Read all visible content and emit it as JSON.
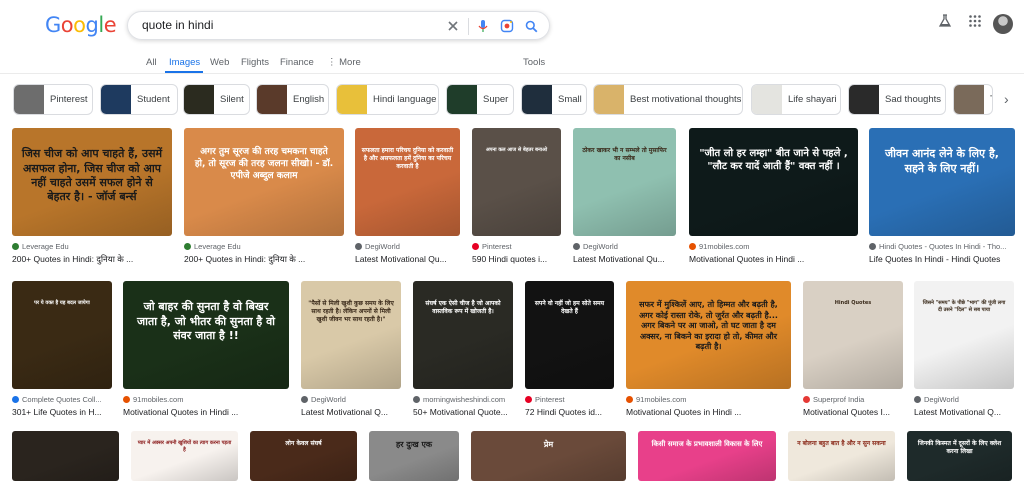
{
  "search": {
    "query": "quote in hindi"
  },
  "logo": {
    "letters": [
      "G",
      "o",
      "o",
      "g",
      "l",
      "e"
    ],
    "colors": [
      "#4285F4",
      "#EA4335",
      "#FBBC05",
      "#4285F4",
      "#34A853",
      "#EA4335"
    ]
  },
  "tabs": [
    {
      "label": "All"
    },
    {
      "label": "Images"
    },
    {
      "label": "Web"
    },
    {
      "label": "Flights"
    },
    {
      "label": "Finance"
    },
    {
      "label": "⋮ More"
    }
  ],
  "tools_label": "Tools",
  "chips": [
    {
      "label": "Pinterest",
      "color": "#6d6d6d"
    },
    {
      "label": "Student",
      "color": "#1e3a5f"
    },
    {
      "label": "Silent",
      "color": "#2b2b1f"
    },
    {
      "label": "English",
      "color": "#5a3a2a"
    },
    {
      "label": "Hindi language",
      "color": "#e8c03a"
    },
    {
      "label": "Super",
      "color": "#1f3d2a"
    },
    {
      "label": "Small",
      "color": "#1f2e3d"
    },
    {
      "label": "Best motivational thoughts",
      "color": "#d9b36a"
    },
    {
      "label": "Life shayari",
      "color": "#e4e4e0"
    },
    {
      "label": "Sad thoughts",
      "color": "#2a2a2a"
    },
    {
      "label": "Tru",
      "color": "#7a6a5a"
    }
  ],
  "row1": [
    {
      "text": "जिस चीज को आप चाहते हैं, उसमें असफल होना, जिस चीज को आप नहीं चाहते उसमें सफल होने से बेहतर है। - जॉर्ज बर्न्स",
      "bg": "#b8752a",
      "fg": "#1a1a1a",
      "source": "Leverage Edu",
      "fav": "#2e7d32",
      "caption": "200+ Quotes in Hindi: दुनिया के ..."
    },
    {
      "text": "अगर तुम सूरज की तरह चमकना चाहते हो, तो सूरज की तरह जलना सीखो। - डॉ. एपीजे अब्दुल कलाम",
      "bg": "#d98a4a",
      "fg": "#ffffff",
      "source": "Leverage Edu",
      "fav": "#2e7d32",
      "caption": "200+ Quotes in Hindi: दुनिया के ..."
    },
    {
      "text": "सफलता हमारा परिचय दुनिया को करवाती है और असफलता हमें दुनिया का परिचय करवाती है",
      "bg": "#c9683a",
      "fg": "#ffffff",
      "source": "DegiWorld",
      "fav": "#5f6368",
      "caption": "Latest Motivational Qu..."
    },
    {
      "text": "अपना कल आज से बेहतर बनाओ",
      "bg": "#5a5048",
      "fg": "#ffffff",
      "source": "Pinterest",
      "fav": "#e60023",
      "caption": "590 Hindi quotes i..."
    },
    {
      "text": "ठोकर खाकर भी न सम्भले तो मुसाफिर का नसीब",
      "bg": "#8fc0b0",
      "fg": "#3a2a1a",
      "source": "DegiWorld",
      "fav": "#5f6368",
      "caption": "Latest Motivational Qu..."
    },
    {
      "text": "\"जीत लो हर लम्हा\" बीत जाने से पहले , \"लौट कर यादें आती हैं\" वक्त नहीं ।",
      "bg": "#0e1a1a",
      "fg": "#ffffff",
      "source": "91mobiles.com",
      "fav": "#e65100",
      "caption": "Motivational Quotes in Hindi ..."
    },
    {
      "text": "जीवन आनंद लेने के लिए है, सहने के लिए नहीं।",
      "bg": "#2a6fb5",
      "fg": "#ffffff",
      "source": "Hindi Quotes - Quotes In Hindi - Tho...",
      "fav": "#5f6368",
      "caption": "Life Quotes In Hindi - Hindi Quotes"
    }
  ],
  "row2": [
    {
      "text": "पर ये वक्त है यह बदल जायेगा",
      "bg": "#3a2a14",
      "fg": "#ffffff",
      "source": "Complete Quotes Coll...",
      "fav": "#1a73e8",
      "caption": "301+ Life Quotes in H..."
    },
    {
      "text": "जो बाहर की सुनता है वो बिखर जाता है, जो भीतर की सुनता है वो संवर जाता है !!",
      "bg": "#1a3018",
      "fg": "#ffffff",
      "source": "91mobiles.com",
      "fav": "#e65100",
      "caption": "Motivational Quotes in Hindi ..."
    },
    {
      "text": "\"पैसों से मिली खुशी कुछ समय के लिए साथ रहती है। लेकिन अपनों से मिली खुशी जीवन भर साथ रहती है।\"",
      "bg": "#d9c9a8",
      "fg": "#3a2a1a",
      "source": "DegiWorld",
      "fav": "#5f6368",
      "caption": "Latest Motivational Q..."
    },
    {
      "text": "संघर्ष एक ऐसी चीज है जो आपको वास्तविक रूप में खोजती है।",
      "bg": "#2a2a24",
      "fg": "#ffffff",
      "source": "morningwisheshindi.com",
      "fav": "#5f6368",
      "caption": "50+ Motivational Quote..."
    },
    {
      "text": "सपने वो नहीं जो हम सोते समय देखते हैं",
      "bg": "#121212",
      "fg": "#ffffff",
      "source": "Pinterest",
      "fav": "#e60023",
      "caption": "72 Hindi Quotes id..."
    },
    {
      "text": "सफर में मुश्किलें आए, तो हिम्मत और बढ़ती है, अगर कोई रास्ता रोके, तो जुर्रत और बढ़ती है... अगर बिकने पर आ जाओ, तो घट जाता है दम अक्सर, ना बिकने का इरादा हो तो, कीमत और बढ़ती है।",
      "bg": "#e08a2a",
      "fg": "#1a1a1a",
      "source": "91mobiles.com",
      "fav": "#e65100",
      "caption": "Motivational Quotes in Hindi ..."
    },
    {
      "text": "Hindi Quotes",
      "bg": "#d9d0c4",
      "fg": "#3a2a1a",
      "source": "Superprof India",
      "fav": "#e53935",
      "caption": "Motivational Quotes I..."
    },
    {
      "text": "जिसने \"समय\" के पीछे \"भाग\" की पूंजी लगा दी उसने \"दिल\" से सब पाया",
      "bg": "#f2f2f2",
      "fg": "#3a2a1a",
      "source": "DegiWorld",
      "fav": "#5f6368",
      "caption": "Latest Motivational Q..."
    }
  ],
  "row3": [
    {
      "text": "",
      "bg": "#2a241e",
      "fg": "#ffffff"
    },
    {
      "text": "प्यार में अक्सर अपनी खुशियों का त्याग करना पड़ता है",
      "bg": "#f7f2ee",
      "fg": "#8a1a1a"
    },
    {
      "text": "लोग केवल संघर्ष",
      "bg": "#4a2a1a",
      "fg": "#ffffff"
    },
    {
      "text": "हर दुःख एक",
      "bg": "#8a8a8a",
      "fg": "#1a1a1a"
    },
    {
      "text": "प्रेम",
      "bg": "#6a4a3a",
      "fg": "#ffffff"
    },
    {
      "text": "किसी समाज के प्रभावशाली विकास के लिए",
      "bg": "#e8408a",
      "fg": "#ffffff"
    },
    {
      "text": "न बोलना बहुत बात है और न सुन सकना",
      "bg": "#efe8dc",
      "fg": "#8a2a1a"
    },
    {
      "text": "जिनकी किस्मत में दूसरों के लिए क्लेश करना लिखा",
      "bg": "#1e2a2a",
      "fg": "#ffffff"
    }
  ]
}
